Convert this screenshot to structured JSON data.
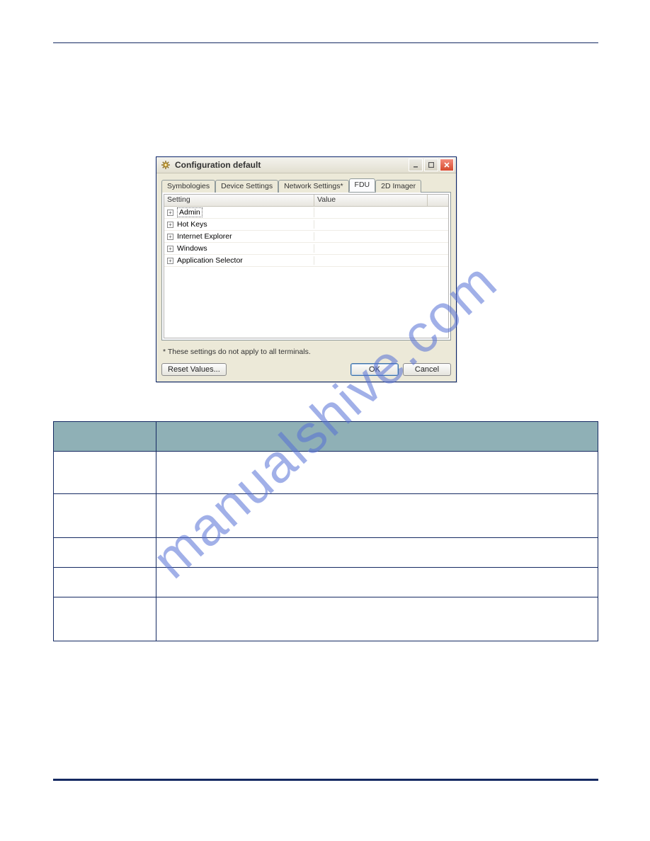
{
  "dialog": {
    "title": "Configuration default",
    "tabs": [
      "Symbologies",
      "Device Settings",
      "Network Settings*",
      "FDU",
      "2D Imager"
    ],
    "active_tab_index": 3,
    "grid_headers": {
      "c1": "Setting",
      "c2": "Value"
    },
    "rows": [
      {
        "label": "Admin",
        "selected": true
      },
      {
        "label": "Hot Keys",
        "selected": false
      },
      {
        "label": "Internet Explorer",
        "selected": false
      },
      {
        "label": "Windows",
        "selected": false
      },
      {
        "label": "Application Selector",
        "selected": false
      }
    ],
    "footnote": "* These settings do not apply to all terminals.",
    "buttons": {
      "reset": "Reset Values...",
      "ok": "OK",
      "cancel": "Cancel"
    }
  },
  "watermark": "manualshive.com"
}
